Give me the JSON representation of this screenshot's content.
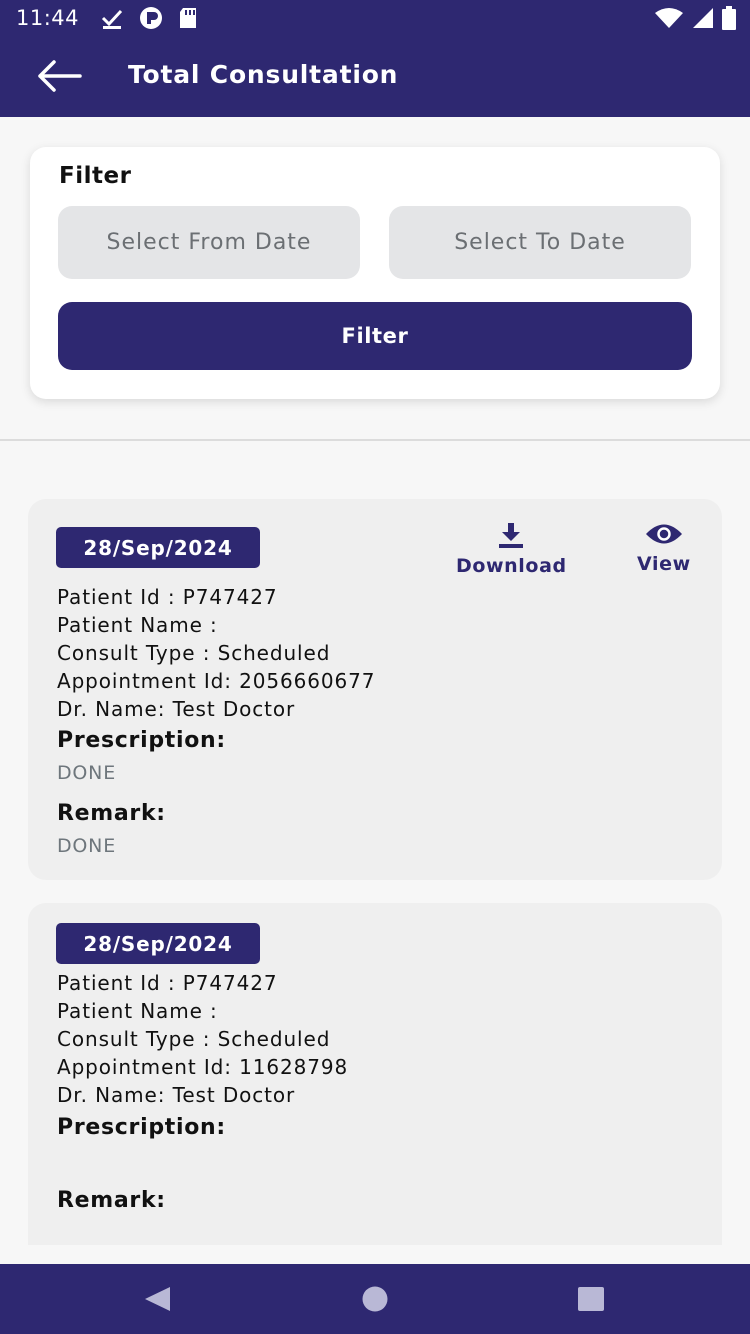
{
  "status_bar": {
    "time": "11:44",
    "left_icons": [
      "download-check-icon",
      "app-notification-icon",
      "sd-card-icon"
    ],
    "right_icons": [
      "wifi-icon",
      "signal-icon",
      "battery-icon"
    ]
  },
  "app_bar": {
    "title": "Total Consultation",
    "back_icon": "arrow-left-icon"
  },
  "filter": {
    "label": "Filter",
    "from_placeholder": "Select From Date",
    "to_placeholder": "Select To Date",
    "button_label": "Filter"
  },
  "consultations": [
    {
      "date": "28/Sep/2024",
      "patient_id": "Patient Id : P747427",
      "patient_name": "Patient Name :",
      "consult_type": "Consult Type : Scheduled",
      "appointment_id": "Appointment Id: 2056660677",
      "doctor": "Dr. Name: Test Doctor",
      "prescription_label": "Prescription:",
      "prescription_value": "DONE",
      "remark_label": "Remark:",
      "remark_value": "DONE",
      "download_label": "Download",
      "view_label": "View"
    },
    {
      "date": "28/Sep/2024",
      "patient_id": "Patient Id : P747427",
      "patient_name": "Patient Name :",
      "consult_type": "Consult Type : Scheduled",
      "appointment_id": "Appointment Id: 11628798",
      "doctor": "Dr. Name: Test Doctor",
      "prescription_label": "Prescription:",
      "prescription_value": "",
      "remark_label": "Remark:",
      "remark_value": ""
    }
  ],
  "nav_bar": {
    "icons": [
      "nav-back-icon",
      "nav-home-icon",
      "nav-recents-icon"
    ]
  },
  "colors": {
    "primary": "#2e2871",
    "card_bg": "#efefef",
    "input_bg": "#e4e5e7",
    "muted_text": "#6e767c"
  }
}
